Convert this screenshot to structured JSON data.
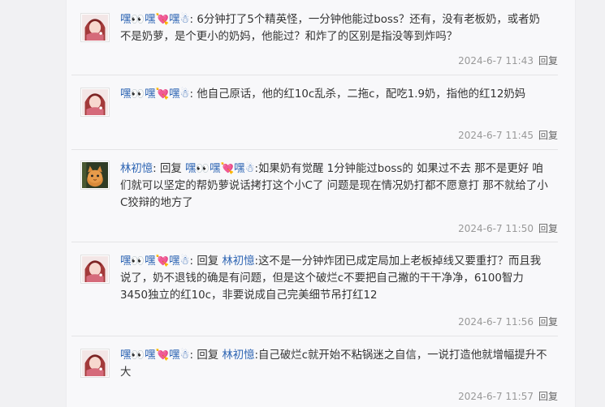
{
  "replies": [
    {
      "user": "嘿👀嘿💘嘿☃",
      "prefix": ": ",
      "reply_word": "",
      "reply_to": "",
      "text": "6分钟打了5个精英怪，一分钟他能过boss？还有，没有老板奶，或者奶不是奶萝，是个更小的奶妈，他能过？和炸了的区别是指没等到炸吗？",
      "time": "2024-6-7 11:43",
      "reply_label": "回复",
      "avatar": "anime-avatar"
    },
    {
      "user": "嘿👀嘿💘嘿☃",
      "prefix": ": ",
      "reply_word": "",
      "reply_to": "",
      "text": "他自己原话，他的红10c乱杀，二拖c，配吃1.9奶，指他的红12奶妈",
      "time": "2024-6-7 11:45",
      "reply_label": "回复",
      "avatar": "anime-avatar"
    },
    {
      "user": "林初憶",
      "prefix": ": ",
      "reply_word": "回复 ",
      "reply_to": "嘿👀嘿💘嘿☃",
      "text": ":如果奶有觉醒 1分钟能过boss的 如果过不去 那不是更好 咱们就可以坚定的帮奶萝说话拷打这个小C了 问题是现在情况奶打都不愿意打 那不就给了小C狡辩的地方了",
      "time": "2024-6-7 11:50",
      "reply_label": "回复",
      "avatar": "cat-avatar"
    },
    {
      "user": "嘿👀嘿💘嘿☃",
      "prefix": ": ",
      "reply_word": "回复 ",
      "reply_to": "林初憶",
      "text": ":这不是一分钟炸团已成定局加上老板掉线又要重打？而且我说了，奶不退钱的确是有问题，但是这个破烂c不要把自己撇的干干净净，6100智力3450独立的红10c，非要说成自己完美细节吊打红12",
      "time": "2024-6-7 11:56",
      "reply_label": "回复",
      "avatar": "anime-avatar"
    },
    {
      "user": "嘿👀嘿💘嘿☃",
      "prefix": ": ",
      "reply_word": "回复 ",
      "reply_to": "林初憶",
      "text": ":自己破烂c就开始不粘锅迷之自信，一说打造他就增幅提升不大",
      "time": "2024-6-7 11:57",
      "reply_label": "回复",
      "avatar": "anime-avatar"
    }
  ]
}
